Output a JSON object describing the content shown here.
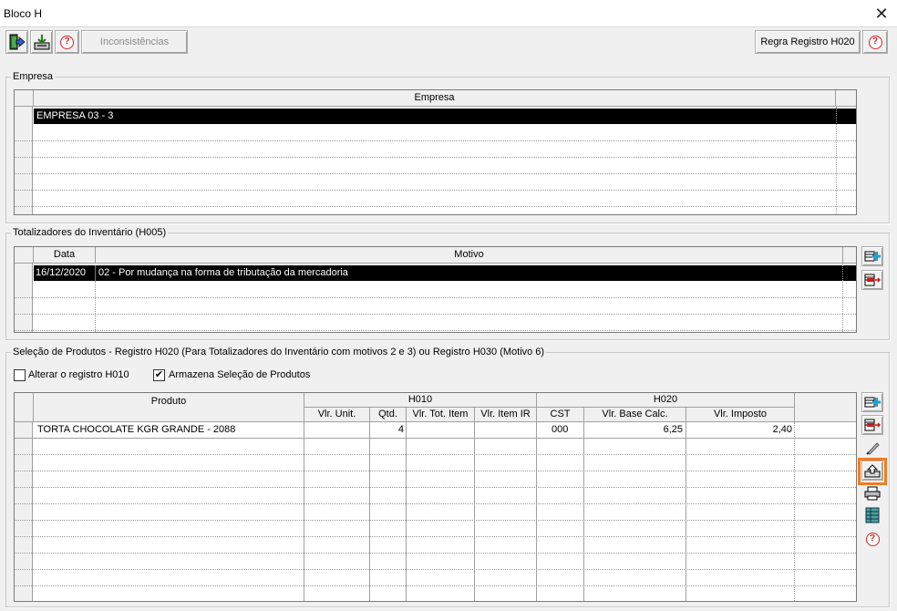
{
  "window": {
    "title": "Bloco H",
    "close_glyph": "✕"
  },
  "toolbar": {
    "icons": [
      "exit-icon",
      "import-icon",
      "help-icon"
    ],
    "inconsistencias_label": "Inconsistências",
    "regra_label": "Regra Registro H020",
    "help_glyph": "?"
  },
  "empresa": {
    "legend": "Empresa",
    "header": "Empresa",
    "rows": [
      "EMPRESA 03 - 3"
    ]
  },
  "totalizadores": {
    "legend": "Totalizadores do Inventário (H005)",
    "headers": {
      "data": "Data",
      "motivo": "Motivo"
    },
    "rows": [
      {
        "data": "16/12/2020",
        "motivo": "02 - Por mudança na forma de tributação da mercadoria"
      }
    ]
  },
  "selecao": {
    "legend": "Seleção de Produtos - Registro H020 (Para Totalizadores do Inventário com motivos 2 e 3) ou Registro H030 (Motivo 6)",
    "alterar_label": "Alterar o registro H010",
    "alterar_checked": false,
    "armazena_label": "Armazena Seleção de Produtos",
    "armazena_checked": true,
    "check_glyph": "✔",
    "headers": {
      "produto": "Produto",
      "h010": "H010",
      "h020": "H020",
      "vlr_unit": "Vlr. Unit.",
      "qtd": "Qtd.",
      "vlr_tot_item": "Vlr. Tot. Item",
      "vlr_item_ir": "Vlr. Item IR",
      "cst": "CST",
      "vlr_base_calc": "Vlr. Base Calc.",
      "vlr_imposto": "Vlr. Imposto"
    },
    "rows": [
      {
        "produto": "TORTA CHOCOLATE KGR GRANDE - 2088",
        "vlr_unit": "",
        "qtd": "4",
        "vlr_tot_item": "",
        "vlr_item_ir": "",
        "cst": "000",
        "vlr_base_calc": "6,25",
        "vlr_imposto": "2,40"
      }
    ],
    "side_buttons": [
      "add-row-icon",
      "remove-row-icon",
      "eraser-icon",
      "export-icon",
      "print-icon",
      "grid-icon",
      "help-icon"
    ]
  },
  "colors": {
    "highlight": "#f07d1e",
    "selected_row": "#000000",
    "help_red": "#d02020"
  }
}
